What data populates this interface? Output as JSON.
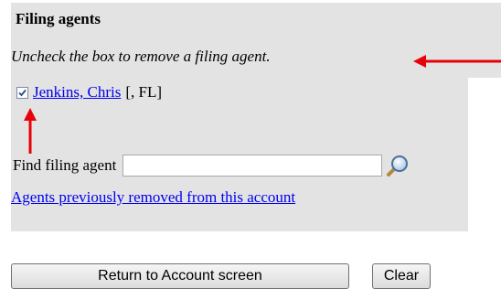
{
  "section": {
    "heading": "Filing agents",
    "instruction": "Uncheck the box to remove a filing agent."
  },
  "agents": [
    {
      "checked": true,
      "name": "Jenkins, Chris",
      "suffix": "[, FL]"
    }
  ],
  "find": {
    "label": "Find filing agent",
    "value": "",
    "search_icon": "magnifier-icon"
  },
  "removed_link": "Agents previously removed from this account",
  "buttons": {
    "return_label": "Return to Account screen",
    "clear_label": "Clear"
  },
  "annotations": {
    "arrow_color": "#e8000b"
  }
}
